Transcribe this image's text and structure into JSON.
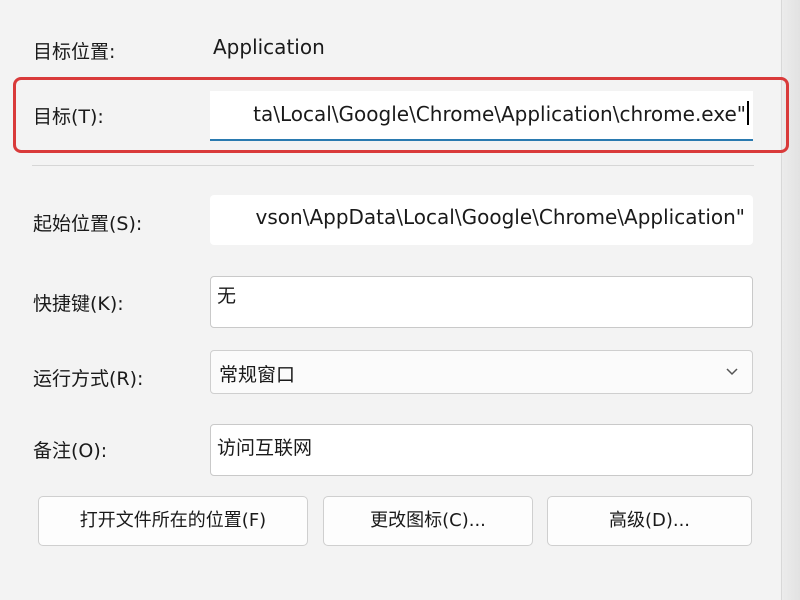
{
  "fields": {
    "target_type_label": "目标位置:",
    "target_type_value": "Application",
    "target_label": "目标(T):",
    "target_value": "ta\\Local\\Google\\Chrome\\Application\\chrome.exe\"",
    "start_in_label": "起始位置(S):",
    "start_in_value": "vson\\AppData\\Local\\Google\\Chrome\\Application\"",
    "shortcut_key_label": "快捷键(K):",
    "shortcut_key_value": "无",
    "run_label": "运行方式(R):",
    "run_value": "常规窗口",
    "comment_label": "备注(O):",
    "comment_value": "访问互联网"
  },
  "buttons": {
    "open_location": "打开文件所在的位置(F)",
    "change_icon": "更改图标(C)...",
    "advanced": "高级(D)..."
  },
  "icons": {
    "dropdown": "chevron-down-icon"
  },
  "colors": {
    "highlight": "#d93a3a",
    "focus_underline": "#2a7ab0"
  }
}
